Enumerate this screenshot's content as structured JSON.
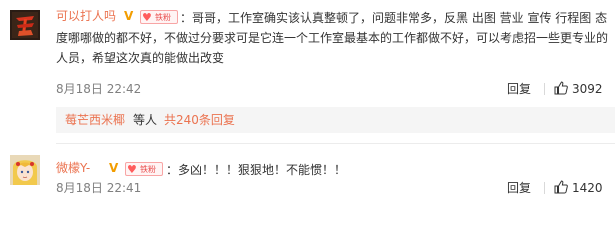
{
  "comments": [
    {
      "username": "可以打人吗",
      "badge_text": "V",
      "fan_label": "铁粉",
      "text": "：哥哥，工作室确实该认真整顿了，问题非常多，反黑 出图 营业 宣传 行程图 态度哪哪做的都不好，不做过分要求可是它连一个工作室最基本的工作都做不好，可以考虑招一些更专业的人员，希望这次真的能做出改变",
      "time": "8月18日 22:42",
      "reply_label": "回复",
      "likes": "3092",
      "replies_preview": {
        "name": "莓芒西米椰",
        "middle": "等人",
        "total": "共240条回复"
      }
    },
    {
      "username": "微檬Y-",
      "badge_text": "V",
      "fan_label": "铁粉",
      "text": "：多凶！！！狠狠地！不能惯！！",
      "time": "8月18日 22:41",
      "reply_label": "回复",
      "likes": "1420"
    }
  ],
  "colors": {
    "username": "#eb7350",
    "text": "#333333",
    "time": "#808080",
    "vip_badge": "#f29d00",
    "fan_badge": "#e94f4f",
    "reply_box_bg": "#f5f5f5"
  },
  "icons": {
    "avatar1": "red-calligraphy-avatar",
    "avatar2": "anime-girl-avatar",
    "like": "thumbs-up-icon",
    "fan": "heart-icon"
  }
}
